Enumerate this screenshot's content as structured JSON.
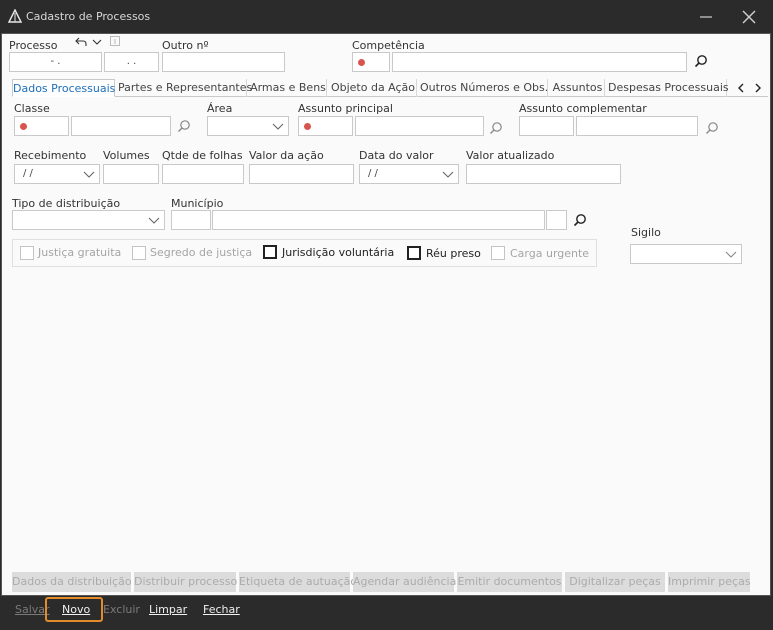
{
  "window": {
    "title": "Cadastro de Processos"
  },
  "header": {
    "processo_label": "Processo",
    "processo_part1": "- .",
    "processo_part2": ". .",
    "outro_label": "Outro nº",
    "competencia_label": "Competência"
  },
  "tabs": [
    {
      "label": "Dados Processuais"
    },
    {
      "label": "Partes e Representantes"
    },
    {
      "label": "Armas e Bens"
    },
    {
      "label": "Objeto da Ação"
    },
    {
      "label": "Outros Números e Obs."
    },
    {
      "label": "Assuntos"
    },
    {
      "label": "Despesas Processuais"
    }
  ],
  "form": {
    "classe_label": "Classe",
    "area_label": "Área",
    "assunto_principal_label": "Assunto principal",
    "assunto_complementar_label": "Assunto complementar",
    "recebimento_label": "Recebimento",
    "recebimento_value": "/ /",
    "volumes_label": "Volumes",
    "qtde_folhas_label": "Qtde de folhas",
    "valor_acao_label": "Valor da ação",
    "data_valor_label": "Data do valor",
    "data_valor_value": "/ /",
    "valor_atualizado_label": "Valor atualizado",
    "tipo_distribuicao_label": "Tipo de distribuição",
    "municipio_label": "Município",
    "sigilo_label": "Sigilo"
  },
  "checkboxes": [
    {
      "label": "Justiça gratuita",
      "enabled": false,
      "checked": false
    },
    {
      "label": "Segredo de justiça",
      "enabled": false,
      "checked": false
    },
    {
      "label": "Jurisdição voluntária",
      "enabled": true,
      "checked": false
    },
    {
      "label": "Réu preso",
      "enabled": true,
      "checked": false
    },
    {
      "label": "Carga urgente",
      "enabled": false,
      "checked": false
    }
  ],
  "actions": [
    {
      "label": "Dados da distribuição"
    },
    {
      "label": "Distribuir processo"
    },
    {
      "label": "Etiqueta de autuação"
    },
    {
      "label": "Agendar audiência"
    },
    {
      "label": "Emitir documentos"
    },
    {
      "label": "Digitalizar peças"
    },
    {
      "label": "Imprimir peças"
    }
  ],
  "bottom": {
    "salvar": "Salvar",
    "novo": "Novo",
    "excluir": "Excluir",
    "limpar": "Limpar",
    "fechar": "Fechar"
  },
  "colors": {
    "required_dot": "#d9534f",
    "accent_tab": "#1d6fb8",
    "highlight": "#e28b2a"
  }
}
